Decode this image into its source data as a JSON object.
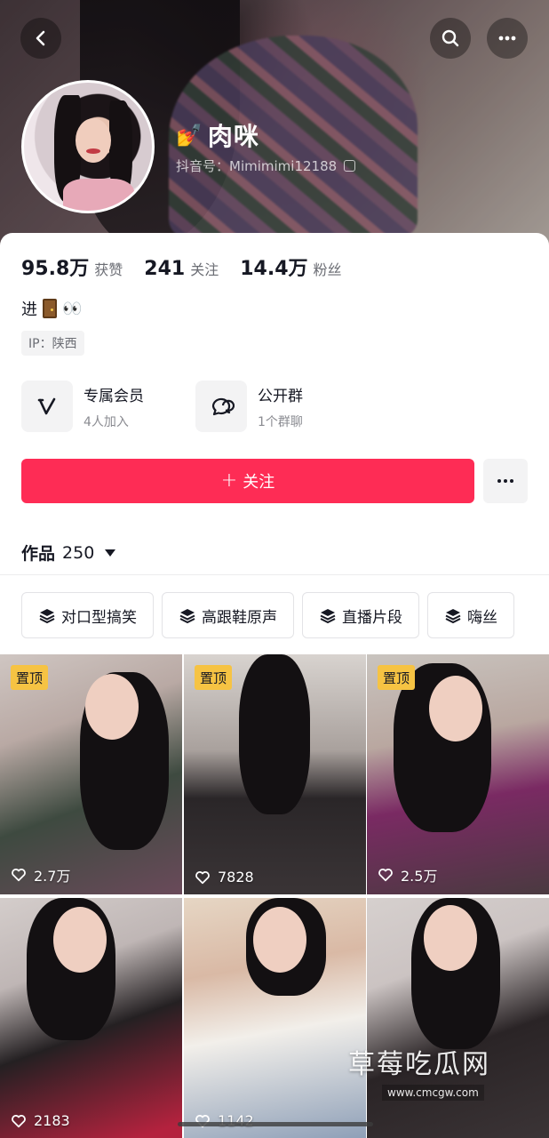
{
  "header": {
    "name": "肉咪",
    "name_emoji": "💅",
    "douyin_id_label": "抖音号：Mimimimi12188",
    "icons": [
      "back-arrow-icon",
      "search-icon",
      "more-icon"
    ]
  },
  "stats": [
    {
      "num": "95.8万",
      "label": "获赞"
    },
    {
      "num": "241",
      "label": "关注"
    },
    {
      "num": "14.4万",
      "label": "粉丝"
    }
  ],
  "bio": {
    "text": "进",
    "eyes": "👀"
  },
  "ip": "IP：陕西",
  "features": {
    "member": {
      "title": "专属会员",
      "sub": "4人加入",
      "icon": "v-membership-icon"
    },
    "group": {
      "title": "公开群",
      "sub": "1个群聊",
      "icon": "group-chat-icon"
    }
  },
  "actions": {
    "follow_label": "关注",
    "follow_color": "#fe2c55"
  },
  "works": {
    "label": "作品",
    "count": "250"
  },
  "collections": [
    "对口型搞笑",
    "高跟鞋原声",
    "直播片段",
    "嗨丝"
  ],
  "tiles": [
    {
      "pinned": "置顶",
      "likes": "2.7万"
    },
    {
      "pinned": "置顶",
      "likes": "7828"
    },
    {
      "pinned": "置顶",
      "likes": "2.5万"
    },
    {
      "pinned": "",
      "likes": "2183"
    },
    {
      "pinned": "",
      "likes": "1142"
    },
    {
      "pinned": "",
      "likes": ""
    }
  ],
  "watermark": {
    "title": "草莓吃瓜网",
    "url": "www.cmcgw.com"
  }
}
